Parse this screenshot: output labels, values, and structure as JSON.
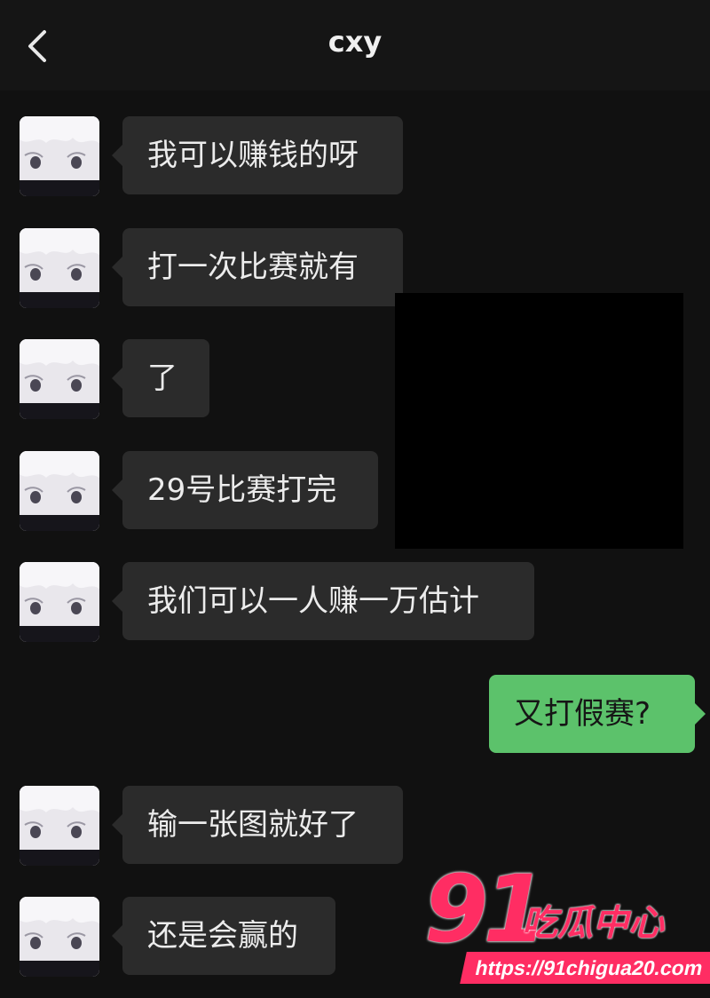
{
  "header": {
    "title": "cxy",
    "back_icon": "chevron-left-icon"
  },
  "messages": [
    {
      "side": "in",
      "text": "我可以赚钱的呀"
    },
    {
      "side": "in",
      "text": "打一次比赛就有"
    },
    {
      "side": "in",
      "text": "了"
    },
    {
      "side": "in",
      "text": "29号比赛打完"
    },
    {
      "side": "in",
      "text": "我们可以一人赚一万估计"
    },
    {
      "side": "out",
      "text": "又打假赛?"
    },
    {
      "side": "in",
      "text": "输一张图就好了"
    },
    {
      "side": "in",
      "text": "还是会赢的"
    }
  ],
  "watermark": {
    "number": "91",
    "brand": "吃瓜中心",
    "url": "https://91chigua20.com",
    "color": "#ff2d63"
  },
  "colors": {
    "background": "#111111",
    "incoming_bubble": "#2b2b2b",
    "outgoing_bubble": "#5cc26b",
    "redaction": "#000000"
  }
}
